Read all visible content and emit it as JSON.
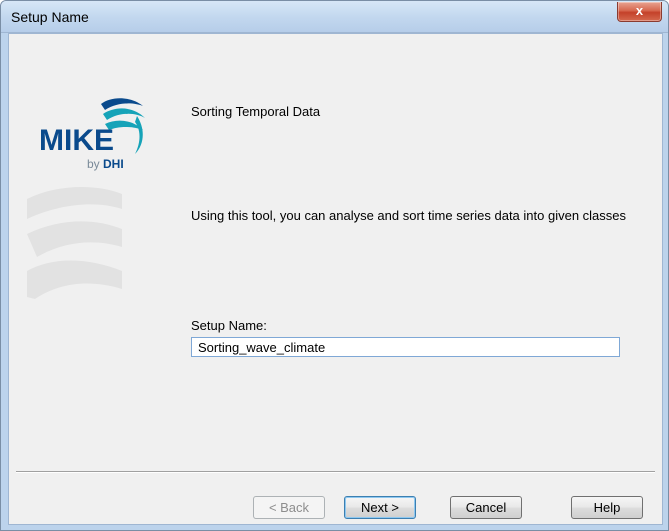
{
  "window": {
    "title": "Setup Name",
    "close_label": "x"
  },
  "logo": {
    "brand": "MIKE",
    "by": "by",
    "company": "DHI"
  },
  "content": {
    "heading": "Sorting Temporal Data",
    "description": "Using this tool, you can analyse and sort time series data into given classes",
    "setup_name_label": "Setup Name:",
    "setup_name_value": "Sorting_wave_climate"
  },
  "buttons": {
    "back": "< Back",
    "next": "Next >",
    "cancel": "Cancel",
    "help": "Help"
  },
  "colors": {
    "brand_blue": "#0a4a8c",
    "brand_teal": "#16a3b8",
    "client_bg": "#f0f0f0",
    "title_bg": "#c3d8ef",
    "close_red": "#c4412a"
  }
}
